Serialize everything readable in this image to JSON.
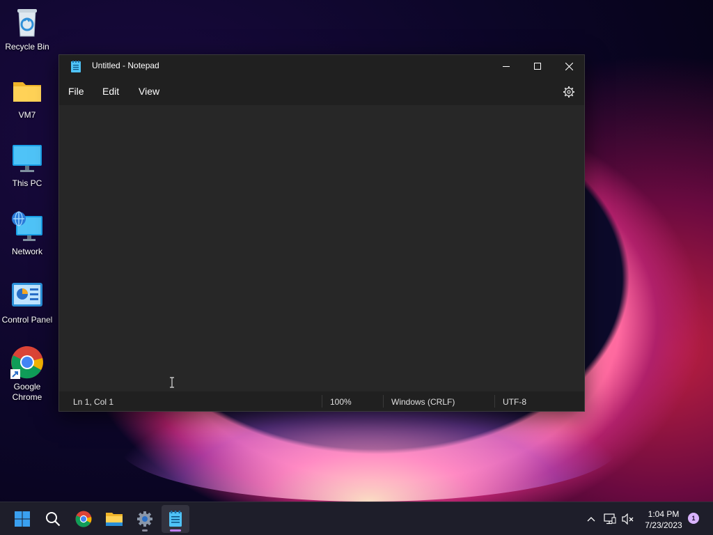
{
  "desktop": {
    "icons": [
      {
        "label": "Recycle Bin"
      },
      {
        "label": "VM7"
      },
      {
        "label": "This PC"
      },
      {
        "label": "Network"
      },
      {
        "label": "Control Panel"
      },
      {
        "label": "Google Chrome"
      }
    ]
  },
  "notepad": {
    "title": "Untitled - Notepad",
    "menu": {
      "file": "File",
      "edit": "Edit",
      "view": "View"
    },
    "content": "",
    "status": {
      "position": "Ln 1, Col 1",
      "zoom": "100%",
      "line_ending": "Windows (CRLF)",
      "encoding": "UTF-8"
    }
  },
  "taskbar": {
    "apps": [
      "start-icon",
      "search-icon",
      "chrome-icon",
      "file-explorer-icon",
      "settings-icon",
      "notepad-icon"
    ],
    "clock": {
      "time": "1:04 PM",
      "date": "7/23/2023"
    },
    "notification_count": "1"
  },
  "colors": {
    "accent": "#c080ff",
    "window_bg": "#272727",
    "titlebar_bg": "#202020"
  }
}
